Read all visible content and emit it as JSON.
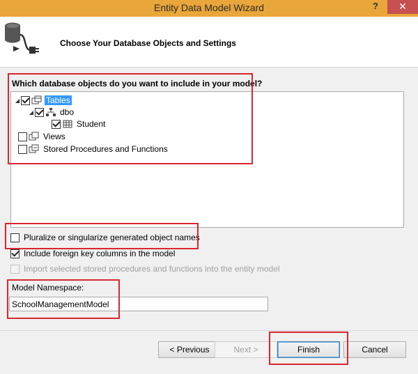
{
  "window": {
    "title": "Entity Data Model Wizard",
    "help": "?",
    "close": "✕"
  },
  "header": {
    "title": "Choose Your Database Objects and Settings",
    "icon": "database-connector-icon"
  },
  "tree": {
    "question": "Which database objects do you want to include in your model?",
    "nodes": [
      {
        "label": "Tables",
        "checked": true,
        "expanded": true,
        "selected": true,
        "icon": "tables-icon"
      },
      {
        "label": "dbo",
        "checked": true,
        "expanded": true,
        "icon": "schema-icon"
      },
      {
        "label": "Student",
        "checked": true,
        "icon": "table-icon"
      },
      {
        "label": "Views",
        "checked": false,
        "icon": "views-icon"
      },
      {
        "label": "Stored Procedures and Functions",
        "checked": false,
        "icon": "procedures-icon"
      }
    ]
  },
  "options": {
    "pluralize": {
      "label": "Pluralize or singularize generated object names",
      "checked": false
    },
    "foreign_keys": {
      "label": "Include foreign key columns in the model",
      "checked": true
    },
    "import_procs": {
      "label": "Import selected stored procedures and functions into the entity model",
      "checked": false,
      "enabled": false
    }
  },
  "namespace": {
    "label": "Model Namespace:",
    "value": "SchoolManagementModel"
  },
  "buttons": {
    "previous": "< Previous",
    "next": "Next >",
    "finish": "Finish",
    "cancel": "Cancel"
  },
  "colors": {
    "titlebar": "#e9a63a",
    "close": "#c75050",
    "highlight": "#d8262f",
    "selection": "#3399ff"
  }
}
